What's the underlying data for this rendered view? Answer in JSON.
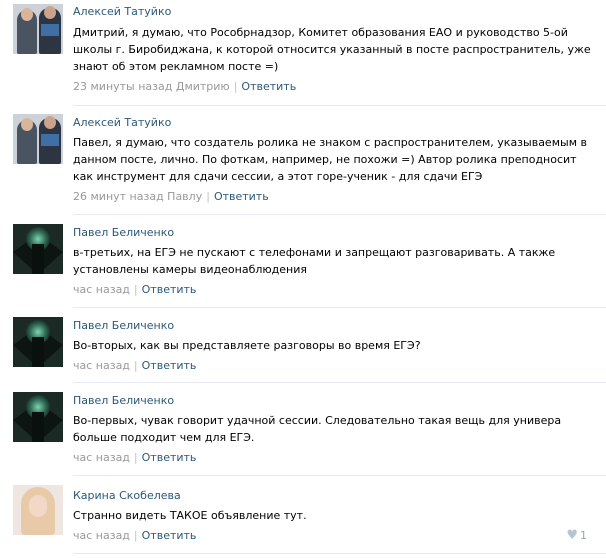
{
  "comments": [
    {
      "author": "Алексей Татуйко",
      "text": "Дмитрий, я думаю, что Рособрнадзор, Комитет образования ЕАО и руководство 5-ой школы г. Биробиджана, к которой относится указанный в посте распространитель, уже знают об этом рекламном посте =)",
      "time": "23 минуты назад Дмитрию",
      "reply": "Ответить",
      "avatar_icon": "user-avatar-two-people"
    },
    {
      "author": "Алексей Татуйко",
      "text": "Павел, я думаю, что создатель ролика не знаком с распространителем, указываемым в данном посте, лично. По фоткам, например, не похожи =) Автор ролика преподносит как инструмент для сдачи сессии, а этот горе-ученик - для сдачи ЕГЭ",
      "time": "26 минут назад Павлу",
      "reply": "Ответить",
      "avatar_icon": "user-avatar-two-people"
    },
    {
      "author": "Павел Беличенко",
      "text": "в-третьих, на ЕГЭ не пускают с телефонами и запрещают разговаривать. А также установлены камеры видеонаблюдения",
      "time": "час назад",
      "reply": "Ответить",
      "avatar_icon": "user-avatar-dark-angel"
    },
    {
      "author": "Павел Беличенко",
      "text": "Во-вторых, как вы представляете разговоры во время ЕГЭ?",
      "time": "час назад",
      "reply": "Ответить",
      "avatar_icon": "user-avatar-dark-angel"
    },
    {
      "author": "Павел Беличенко",
      "text": "Во-первых, чувак говорит удачной сессии. Следовательно такая вещь для универа больше подходит чем для ЕГЭ.",
      "time": "час назад",
      "reply": "Ответить",
      "avatar_icon": "user-avatar-dark-angel"
    },
    {
      "author": "Карина Скобелева",
      "text": "Странно видеть ТАКОЕ объявление тут.",
      "time": "час назад",
      "reply": "Ответить",
      "avatar_icon": "user-avatar-girl",
      "likes": "1"
    }
  ],
  "colors": {
    "link": "#2b587a",
    "meta": "#999999",
    "divider": "#e6e9ed"
  },
  "icons": {
    "like": "heart-icon"
  }
}
